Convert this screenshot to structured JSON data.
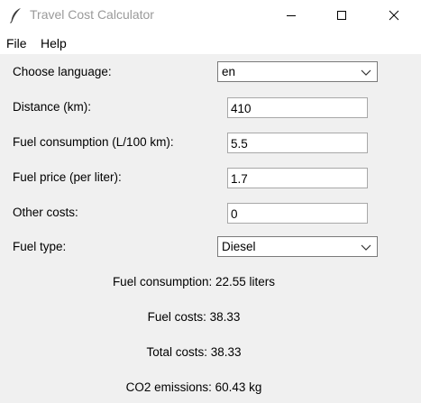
{
  "window": {
    "title": "Travel Cost Calculator",
    "controls": [
      "minimize",
      "maximize",
      "close"
    ]
  },
  "menu": {
    "items": [
      "File",
      "Help"
    ]
  },
  "form": {
    "language": {
      "label": "Choose language:",
      "value": "en"
    },
    "distance": {
      "label": "Distance (km):",
      "value": "410"
    },
    "consumption": {
      "label": "Fuel consumption (L/100 km):",
      "value": "5.5"
    },
    "price": {
      "label": "Fuel price (per liter):",
      "value": "1.7"
    },
    "other": {
      "label": "Other costs:",
      "value": "0"
    },
    "fuel_type": {
      "label": "Fuel type:",
      "value": "Diesel"
    }
  },
  "results": {
    "fuel_consumption": "Fuel consumption: 22.55 liters",
    "fuel_costs": "Fuel costs: 38.33",
    "total_costs": "Total costs: 38.33",
    "co2": "CO2 emissions: 60.43 kg"
  },
  "icons": {
    "app": "feather-icon",
    "minimize": "minimize-icon",
    "maximize": "maximize-icon",
    "close": "close-icon",
    "dropdown": "chevron-down-icon"
  },
  "colors": {
    "window_bg": "#f0f0f0",
    "titlebar_bg": "#ffffff",
    "title_text": "#9a9a9a",
    "field_bg": "#ffffff"
  }
}
